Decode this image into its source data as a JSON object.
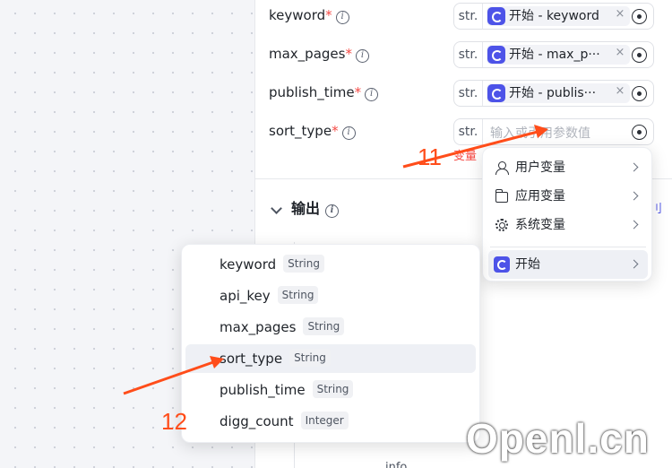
{
  "params": [
    {
      "name": "keyword",
      "type": "str.",
      "source": "开始 - keyword"
    },
    {
      "name": "max_pages",
      "type": "str.",
      "source": "开始 - max_p···"
    },
    {
      "name": "publish_time",
      "type": "str.",
      "source": "开始 - publis···"
    },
    {
      "name": "sort_type",
      "type": "str.",
      "placeholder": "输入或引用参数值",
      "error": "变量"
    }
  ],
  "required_mark": "*",
  "close_glyph": "×",
  "output_section": {
    "title": "输出",
    "edge_link": "刂"
  },
  "tail_text": "info",
  "variable_menu": {
    "items": [
      {
        "label": "用户变量",
        "icon": "user-icon"
      },
      {
        "label": "应用变量",
        "icon": "folder-icon"
      },
      {
        "label": "系统变量",
        "icon": "gear-icon"
      },
      {
        "label": "开始",
        "icon": "start-node-icon"
      }
    ]
  },
  "variable_list": [
    {
      "name": "keyword",
      "type": "String"
    },
    {
      "name": "api_key",
      "type": "String"
    },
    {
      "name": "max_pages",
      "type": "String"
    },
    {
      "name": "sort_type",
      "type": "String"
    },
    {
      "name": "publish_time",
      "type": "String"
    },
    {
      "name": "digg_count",
      "type": "Integer"
    }
  ],
  "annotations": {
    "step_11": "11",
    "step_12": "12",
    "accent_color": "#ff4d1a"
  },
  "watermark": "Openl.cn",
  "colors": {
    "brand": "#4d53e8",
    "error": "#f54a45"
  }
}
